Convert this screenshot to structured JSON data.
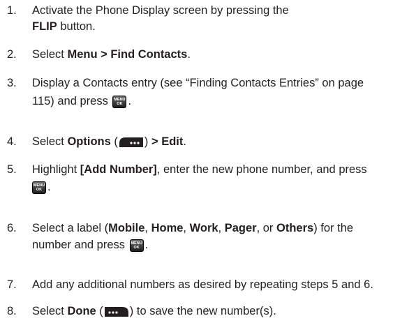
{
  "steps": [
    {
      "num": "1.",
      "l1": "Activate the Phone Display screen by pressing the",
      "b1": "FLIP",
      "l2": " button."
    },
    {
      "num": "2.",
      "t1": "Select ",
      "b1": "Menu > Find Contacts",
      "t2": "."
    },
    {
      "num": "3.",
      "l1": "Display a Contacts entry (see “Finding Contacts Entries” on page",
      "l2a": "115) and press ",
      "l2b": "."
    },
    {
      "num": "4.",
      "t1": "Select ",
      "b1": "Options",
      "t2": " (",
      "t3": ") ",
      "b2": "> Edit",
      "t4": "."
    },
    {
      "num": "5.",
      "t1": "Highlight ",
      "b1": "[Add Number]",
      "t2": ", enter the new phone number, and press",
      "l2b": "."
    },
    {
      "num": "6.",
      "t1": "Select a label (",
      "b1": "Mobile",
      "s1": ", ",
      "b2": "Home",
      "s2": ", ",
      "b3": "Work",
      "s3": ", ",
      "b4": "Pager",
      "s4": ", or ",
      "b5": "Others",
      "t2": ") for the",
      "l2a": "number and press ",
      "l2b": "."
    },
    {
      "num": "7.",
      "l1": "Add any additional numbers as desired by repeating steps 5 and 6."
    },
    {
      "num": "8.",
      "t1": "Select ",
      "b1": "Done",
      "t2": " (",
      "t3": ") to save the new number(s)."
    }
  ],
  "icons": {
    "menu_ok_top": "MENU",
    "menu_ok_bottom": "OK"
  }
}
